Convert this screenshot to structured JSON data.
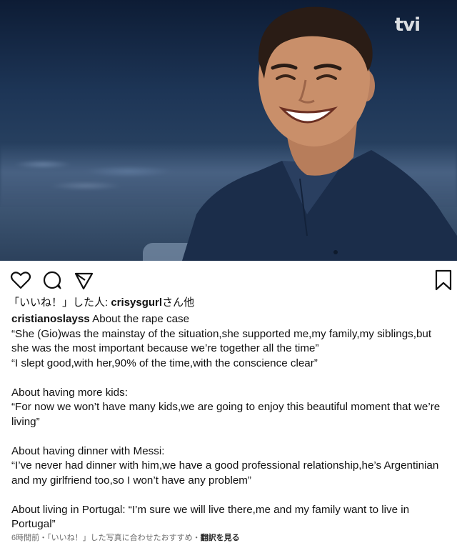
{
  "photo": {
    "watermark": "tvi",
    "colors": {
      "sky_top": "#0d1c35",
      "sky_bottom": "#49607c",
      "shirt": "#1b2d4a",
      "skin": "#c98f6a"
    }
  },
  "actions": {
    "like_icon": "heart-icon",
    "comment_icon": "comment-icon",
    "share_icon": "send-icon",
    "save_icon": "bookmark-icon"
  },
  "likes": {
    "prefix": "「いいね！」した人: ",
    "user": "crisysgurl",
    "suffix": "さん他"
  },
  "caption": {
    "username": "cristianoslayss",
    "line1": " About the rape case",
    "line2": "“She (Gio)was the mainstay of the situation,she supported me,my family,my siblings,but she was the most important because we’re together all the time”",
    "line3": "“I slept good,with her,90% of the time,with the conscience clear”",
    "line4": "About having more kids:",
    "line5": "“For now we won’t have many kids,we are going to enjoy this beautiful moment that we’re living”",
    "line6": "About having dinner with Messi:",
    "line7": "“I’ve never had dinner with him,we have a good professional relationship,he’s Argentinian and my girlfriend too,so I won’t have any problem”",
    "line8": "About living in Portugal: “I’m sure we will live there,me and my family want to live in Portugal”"
  },
  "footer": {
    "meta": "6時間前・「いいね！」した写真に合わせたおすすめ・",
    "translate": "翻訳を見る"
  }
}
